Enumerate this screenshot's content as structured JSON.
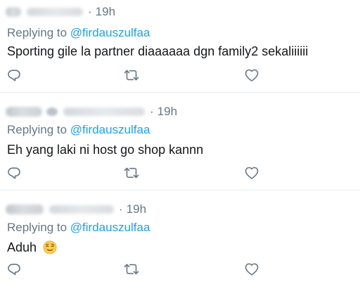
{
  "tweets": [
    {
      "timestamp": "19h",
      "dot": "·",
      "replying_prefix": "Replying to",
      "replying_to": "@firdauszulfaa",
      "text": "Sporting gile la partner diaaaaaa dgn family2 sekaliiiiii"
    },
    {
      "timestamp": "19h",
      "dot": "·",
      "replying_prefix": "Replying to",
      "replying_to": "@firdauszulfaa",
      "text": "Eh yang laki ni host go shop kannn"
    },
    {
      "timestamp": "19h",
      "dot": "·",
      "replying_prefix": "Replying to",
      "replying_to": "@firdauszulfaa",
      "text": "Aduh",
      "emoji": "relieved-face"
    }
  ],
  "icons": {
    "reply": "reply-icon",
    "retweet": "retweet-icon",
    "like": "heart-icon"
  },
  "colors": {
    "secondary_text": "#657786",
    "mention": "#1da1f2",
    "body_text": "#14171a",
    "divider": "#e6ecf0"
  }
}
